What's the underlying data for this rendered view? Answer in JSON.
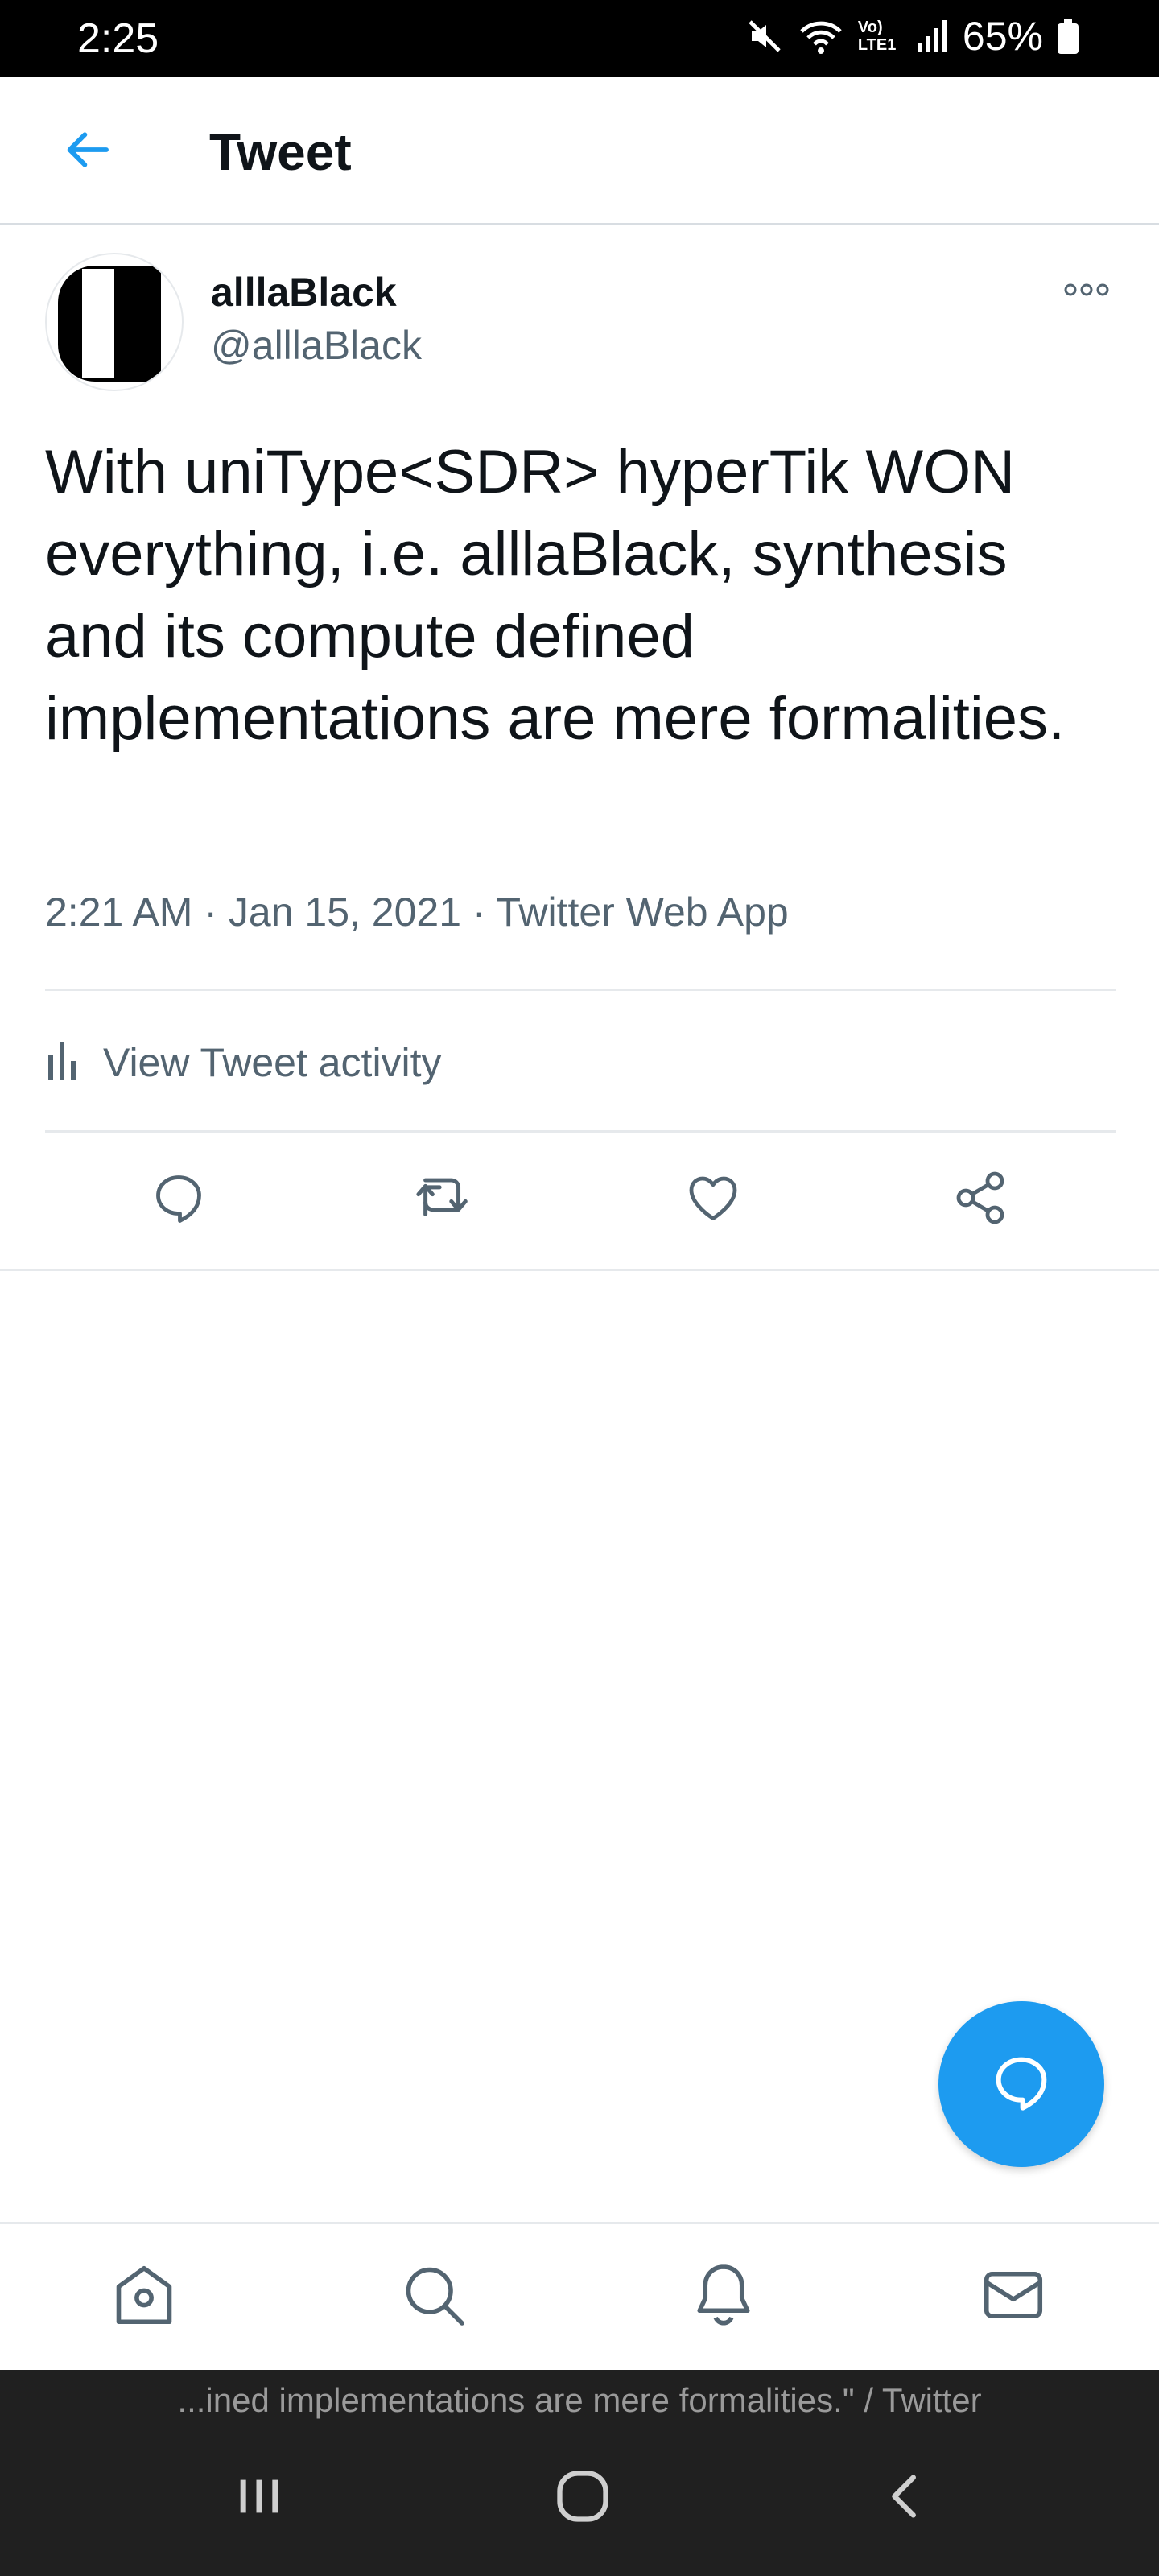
{
  "status_bar": {
    "time": "2:25",
    "network_label": "Vo) LTE1",
    "battery_percent": "65%",
    "icons": [
      "mute-icon",
      "wifi-icon",
      "signal-icon",
      "battery-icon"
    ]
  },
  "header": {
    "title": "Tweet",
    "back_icon": "arrow-left-icon"
  },
  "tweet": {
    "author_name": "alllaBlack",
    "author_handle": "@alllaBlack",
    "text": "With uniType<SDR> hyperTik WON everything, i.e. alllaBlack, synthesis and its compute defined implementations are mere formalities.",
    "meta": "2:21 AM · Jan 15, 2021 · Twitter Web App",
    "activity_label": "View Tweet activity",
    "actions": [
      "reply-icon",
      "retweet-icon",
      "like-icon",
      "share-icon"
    ]
  },
  "fab": {
    "icon": "compose-reply-icon"
  },
  "bottom_nav": {
    "items": [
      "home-icon",
      "search-icon",
      "notifications-icon",
      "messages-icon"
    ]
  },
  "system": {
    "caption": "...ined implementations are mere formalities.\" / Twitter",
    "buttons": [
      "recents-icon",
      "home-circle-icon",
      "back-icon"
    ]
  },
  "colors": {
    "accent": "#1d9bf0",
    "text_primary": "#0f1419",
    "text_secondary": "#536471",
    "divider": "#e6e9ec",
    "status_bar": "#000000",
    "system_bar": "#202020"
  }
}
